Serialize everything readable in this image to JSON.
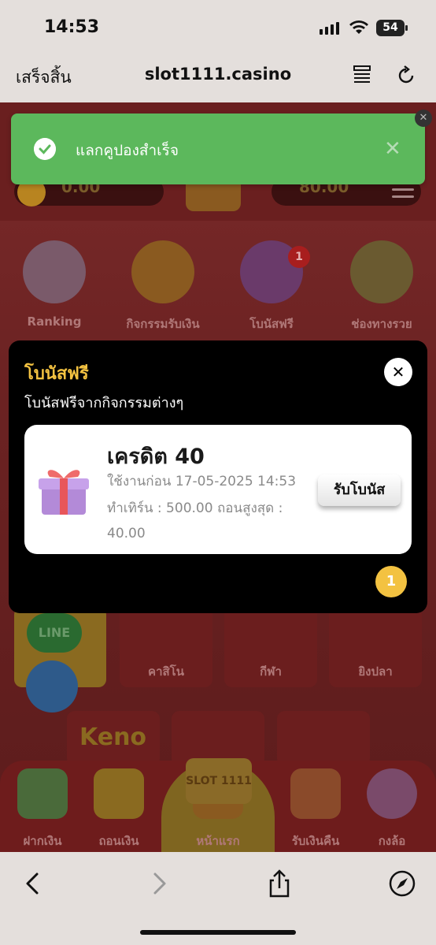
{
  "status_bar": {
    "time": "14:53",
    "battery": "54"
  },
  "address_bar": {
    "done_label": "เสร็จสิ้น",
    "url": "slot1111.casino"
  },
  "toast": {
    "message": "แลกคูปองสำเร็จ"
  },
  "balances": {
    "left": "0.00",
    "right": "80.00"
  },
  "categories": [
    {
      "label": "Ranking"
    },
    {
      "label": "กิจกรรมรับเงิน"
    },
    {
      "label": "โบนัสฟรี",
      "badge": "1"
    },
    {
      "label": "ช่องทางรวย"
    }
  ],
  "game_tiles": [
    {
      "label": "คาสิโน"
    },
    {
      "label": "กีฬา"
    },
    {
      "label": "ยิงปลา"
    }
  ],
  "line_label": "LINE",
  "keno_label": "Keno",
  "modal": {
    "title": "โบนัสฟรี",
    "subtitle": "โบนัสฟรีจากกิจกรรมต่างๆ",
    "card": {
      "credit": "เครดิต 40",
      "valid_until": "ใช้งานก่อน 17-05-2025 14:53",
      "turnover": "ทำเทิร์น : 500.00 ถอนสูงสุด : 40.00",
      "claim_label": "รับโบนัส"
    },
    "page": "1"
  },
  "bottom_nav": [
    {
      "label": "ฝากเงิน"
    },
    {
      "label": "ถอนเงิน"
    },
    {
      "label": "หน้าแรก"
    },
    {
      "label": "รับเงินคืน"
    },
    {
      "label": "กงล้อ"
    }
  ],
  "logo_text": "SLOT 1111",
  "colors": {
    "toast": "#5cb85c",
    "accent": "#f3c241",
    "page_bg": "#6b2222"
  }
}
